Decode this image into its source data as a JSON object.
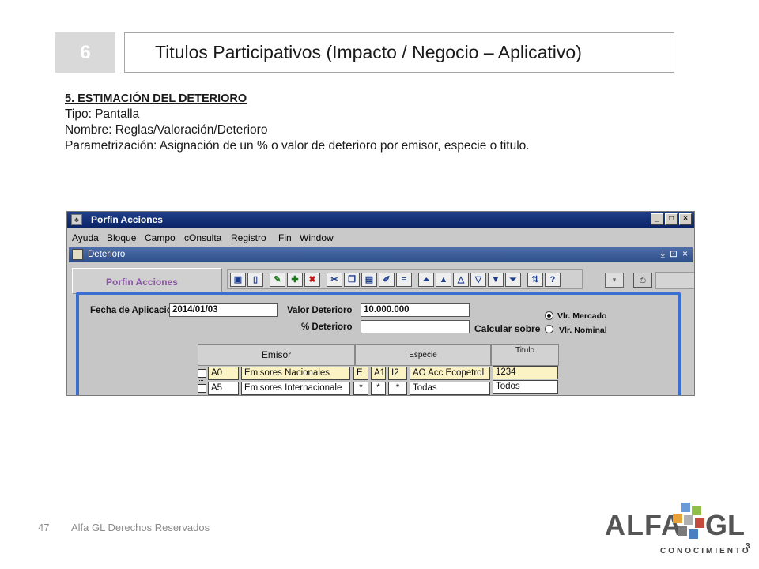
{
  "slide": {
    "number": "6",
    "title": "Titulos Participativos (Impacto / Negocio – Aplicativo)",
    "section_heading": "5. ESTIMACIÓN DEL DETERIORO",
    "tipo": "Tipo: Pantalla",
    "nombre": "Nombre: Reglas/Valoración/Deterioro",
    "parametrizacion": "Parametrización: Asignación de un % o valor de deterioro por emisor, especie o titulo."
  },
  "app": {
    "window_title": "Porfin Acciones",
    "window_buttons": [
      "_",
      "□",
      "×"
    ],
    "menu": [
      "Ayuda",
      "Bloque",
      "Campo",
      "cOnsulta",
      "Registro",
      "Fin",
      "Window"
    ],
    "subwindow_title": "Deterioro",
    "subwindow_buttons": [
      "⤓",
      "⊡",
      "×"
    ],
    "left_panel_label": "Porfin Acciones",
    "form": {
      "fecha_label": "Fecha de Aplicación",
      "fecha_value": "2014/01/03",
      "valor_label": "Valor Deterioro",
      "valor_value": "10.000.000",
      "pct_label": "% Deterioro",
      "pct_value": "",
      "calcular_label": "Calcular sobre",
      "radio_mercado": "Vlr. Mercado",
      "radio_nominal": "Vlr. Nominal",
      "selected_radio": "Vlr. Mercado"
    },
    "table": {
      "headers": {
        "emisor": "Emisor",
        "especie": "Especie",
        "titulo": "Titulo"
      },
      "rows": [
        {
          "code": "A0",
          "emisor": "Emisores Nacionales",
          "e1": "E",
          "e2": "A1",
          "e3": "I2",
          "especie": "AO Acc Ecopetrol",
          "titulo": "1234"
        },
        {
          "code": "A5",
          "emisor": "Emisores Internacionale",
          "e1": "*",
          "e2": "*",
          "e3": "*",
          "especie": "Todas",
          "titulo": "Todos"
        }
      ]
    }
  },
  "footer": {
    "page_number": "47",
    "copyright": "Alfa GL Derechos Reservados",
    "logo_left": "ALFA",
    "logo_right": "GL",
    "logo_sub": "CONOCIMIENTO",
    "logo_sup": "3"
  },
  "colors": {
    "accent_blue": "#3a6fcf",
    "titlebar": "#0a2466",
    "highlight_field": "#fbf3c4",
    "panel_label": "#8b55a6"
  }
}
